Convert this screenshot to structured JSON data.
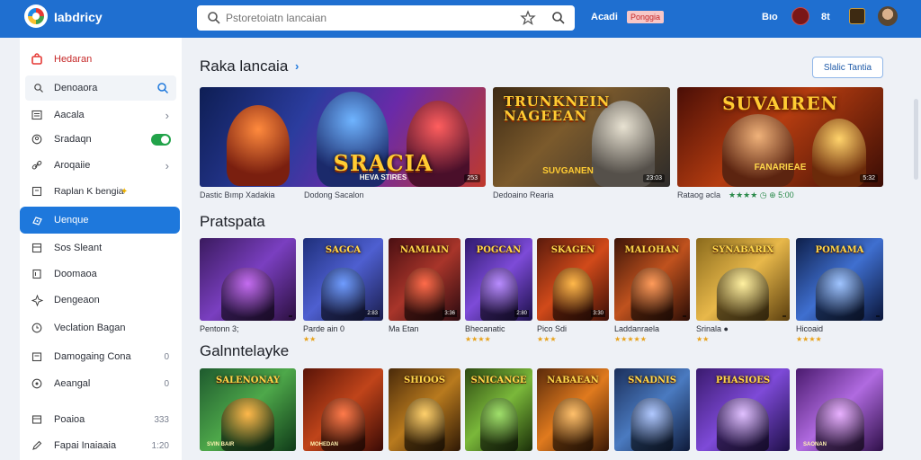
{
  "app": {
    "title": "Iabdricy"
  },
  "search": {
    "placeholder": "Pstoretoiatn lancaian"
  },
  "header": {
    "text1": "Acadi",
    "badge": "Ponggia",
    "text2": "Bıo",
    "text3": "8t"
  },
  "sidebar": {
    "items": [
      {
        "label": "Hedaran",
        "icon": "bag-icon"
      },
      {
        "label": "Denoaora",
        "icon": "search-icon"
      },
      {
        "label": "Aacala",
        "icon": "list-icon",
        "trail": "›"
      },
      {
        "label": "Sradaqn",
        "icon": "user-icon"
      },
      {
        "label": "Aroqaiie",
        "icon": "link-icon",
        "trail": "›"
      },
      {
        "label": "Raplan K bengia",
        "icon": "tag-icon"
      },
      {
        "label": "Uenque",
        "icon": "gamepad-icon"
      },
      {
        "label": "Sos Sleant",
        "icon": "grid-icon"
      },
      {
        "label": "Doomaoa",
        "icon": "book-icon"
      },
      {
        "label": "Dengeaon",
        "icon": "puzzle-icon"
      },
      {
        "label": "Veclation Bagan",
        "icon": "clock-icon"
      },
      {
        "label": "Damogaing Cona",
        "icon": "folder-icon",
        "trail": "0"
      },
      {
        "label": "Aeangal",
        "icon": "circle-icon",
        "trail": "0"
      },
      {
        "label": "Poaioa",
        "icon": "card-icon",
        "trail": "333"
      },
      {
        "label": "Fapai Inaiaaia",
        "icon": "pen-icon",
        "trail": "1:20"
      }
    ]
  },
  "main": {
    "section1": {
      "title": "Raka lancaia",
      "see_all": "Slalic Tantia"
    },
    "banners": [
      {
        "title": "SRACIA",
        "subtitle": "HEVA STIRES",
        "tag": "253",
        "caption": "Dastic Bımp Xadakia",
        "caption2": "Dodong Sacalon"
      },
      {
        "title": "TRUNKNEIN NAGEEAN",
        "subtitle": "SUVGANEN",
        "tag": "23:03",
        "caption": "Dedoaino Rearia",
        "caption2": ""
      },
      {
        "title": "SUVAIREN",
        "subtitle": "FANARIEAE",
        "tag": "5:32",
        "caption": "Rataog əcla",
        "caption2": "★★★★ ◷ ⊕ 5:00"
      }
    ],
    "section2": {
      "title": "Pratspata"
    },
    "row2": [
      {
        "title": "",
        "badge": "",
        "caption": "Pentonn 3;",
        "stars": ""
      },
      {
        "title": "SAGCA",
        "badge": "2:83",
        "caption": "Parde ain 0",
        "stars": "★★"
      },
      {
        "title": "NAMIAIN",
        "badge": "3:36",
        "caption": "Ma Etan",
        "stars": ""
      },
      {
        "title": "POGCAN",
        "badge": "2:80",
        "caption": "Bhecanatic",
        "stars": "★★★★"
      },
      {
        "title": "SKAGEN",
        "badge": "3:30",
        "caption": "Pico Sdi",
        "stars": "★★★"
      },
      {
        "title": "MALOHAN",
        "badge": "",
        "caption": "Laddanraela",
        "stars": "★★★★★"
      },
      {
        "title": "SYNABARIX",
        "badge": "",
        "caption": "Srinala ●",
        "stars": "★★"
      },
      {
        "title": "POMAMA",
        "badge": "",
        "caption": "Hicoaid",
        "stars": "★★★★"
      }
    ],
    "section3": {
      "title": "Galnntelayke"
    },
    "row3": [
      {
        "title": "SALENONAY",
        "foot": "SVIN BAIR"
      },
      {
        "title": "",
        "foot": "MOHEDAN"
      },
      {
        "title": "SHIOOS",
        "foot": ""
      },
      {
        "title": "SNICANGE",
        "foot": ""
      },
      {
        "title": "NABAEAN",
        "foot": ""
      },
      {
        "title": "SNADNIS",
        "foot": ""
      },
      {
        "title": "PHASIOES",
        "foot": ""
      },
      {
        "title": "",
        "foot": "SAONAN"
      }
    ]
  },
  "colors": {
    "topbar": "#1f6fd0",
    "accent": "#1e78dc",
    "toggle": "#22a34a"
  }
}
